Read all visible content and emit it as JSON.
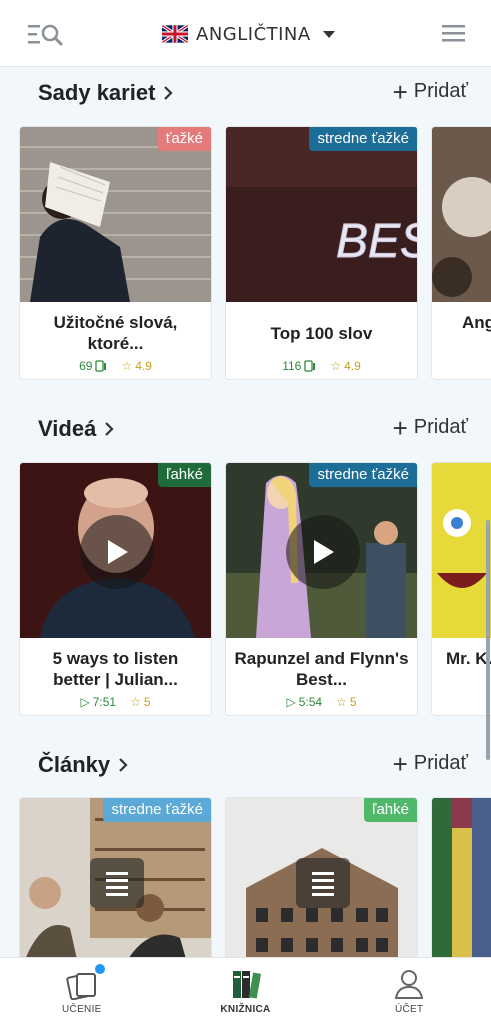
{
  "header": {
    "language_label": "ANGLIČTINA",
    "language_flag": "uk-flag-icon",
    "left_icon": "menu-search-icon",
    "right_icon": "hamburger-icon"
  },
  "sections": {
    "flashcards": {
      "title": "Sady kariet",
      "add_label": "Pridať",
      "cards": [
        {
          "badge": "ťažké",
          "title": "Užitočné slová, ktoré...",
          "count": "69",
          "rating": "4.9"
        },
        {
          "badge": "stredne ťažké",
          "title": "Top 100 slov",
          "count": "116",
          "rating": "4.9"
        },
        {
          "title": "Ang... z..."
        }
      ]
    },
    "videos": {
      "title": "Videá",
      "add_label": "Pridať",
      "cards": [
        {
          "badge": "ľahké",
          "title": "5 ways to listen better | Julian...",
          "duration": "7:51",
          "rating": "5"
        },
        {
          "badge": "stredne ťažké",
          "title": "Rapunzel and Flynn's Best...",
          "duration": "5:54",
          "rating": "5"
        },
        {
          "title": "Mr. K... W..."
        }
      ]
    },
    "articles": {
      "title": "Články",
      "add_label": "Pridať",
      "cards": [
        {
          "badge": "stredne ťažké"
        },
        {
          "badge": "ľahké"
        },
        {}
      ]
    }
  },
  "bottom_nav": {
    "items": [
      {
        "label": "UČENIE",
        "icon": "cards-icon"
      },
      {
        "label": "KNIŽNICA",
        "icon": "books-icon",
        "active": true
      },
      {
        "label": "ÚČET",
        "icon": "user-icon"
      }
    ]
  },
  "colors": {
    "badge_hard": "#e47a7a",
    "badge_medium": "#1c6d97",
    "badge_easy": "#1f6b3a",
    "accent_blue": "#2196f3"
  }
}
